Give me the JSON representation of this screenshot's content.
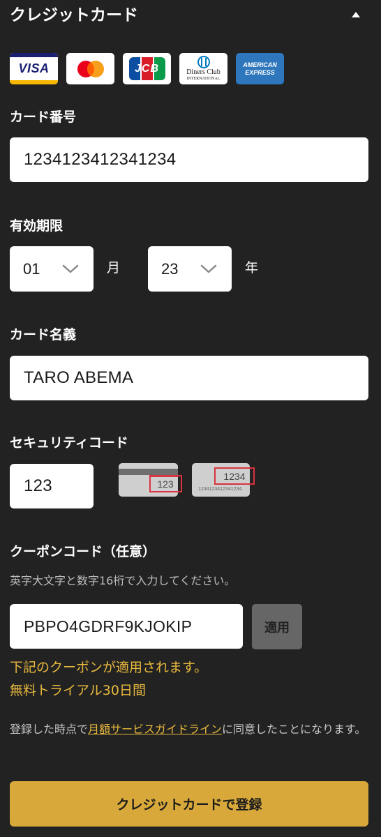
{
  "header": {
    "title": "クレジットカード"
  },
  "brands": [
    {
      "name": "VISA"
    },
    {
      "name": "Mastercard"
    },
    {
      "name": "JCB"
    },
    {
      "name": "Diners Club",
      "sub": "INTERNATIONAL"
    },
    {
      "name": "AMERICAN",
      "sub": "EXPRESS"
    }
  ],
  "card_number": {
    "label": "カード番号",
    "value": "1234123412341234"
  },
  "expiry": {
    "label": "有効期限",
    "month_value": "01",
    "month_unit": "月",
    "year_value": "23",
    "year_unit": "年"
  },
  "card_name": {
    "label": "カード名義",
    "value": "TARO ABEMA"
  },
  "security_code": {
    "label": "セキュリティコード",
    "value": "123",
    "back_card_code": "123",
    "front_card_code": "1234",
    "front_card_number": "1234123412341234"
  },
  "coupon": {
    "label": "クーポンコード（任意）",
    "hint": "英字大文字と数字16桁で入力してください。",
    "value": "PBPO4GDRF9KJOKIP",
    "apply_label": "適用",
    "message_line1": "下記のクーポンが適用されます。",
    "message_line2": "無料トライアル30日間"
  },
  "terms": {
    "prefix": "登録した時点で",
    "link": "月額サービスガイドライン",
    "suffix": "に同意したことになります。"
  },
  "submit": {
    "label": "クレジットカードで登録"
  },
  "colors": {
    "background": "#222222",
    "accent": "#e8b93e",
    "button": "#d8a93a",
    "apply_disabled": "#666666"
  }
}
